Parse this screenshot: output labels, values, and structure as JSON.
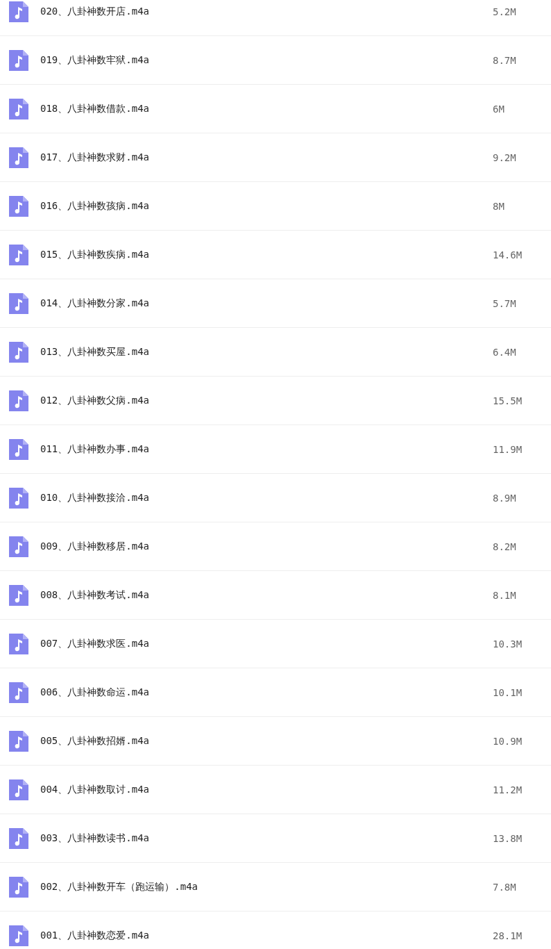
{
  "files": [
    {
      "name": "020、八卦神数开店.m4a",
      "size": "5.2M"
    },
    {
      "name": "019、八卦神数牢狱.m4a",
      "size": "8.7M"
    },
    {
      "name": "018、八卦神数借款.m4a",
      "size": "6M"
    },
    {
      "name": "017、八卦神数求财.m4a",
      "size": "9.2M"
    },
    {
      "name": "016、八卦神数孩病.m4a",
      "size": "8M"
    },
    {
      "name": "015、八卦神数疾病.m4a",
      "size": "14.6M"
    },
    {
      "name": "014、八卦神数分家.m4a",
      "size": "5.7M"
    },
    {
      "name": "013、八卦神数买屋.m4a",
      "size": "6.4M"
    },
    {
      "name": "012、八卦神数父病.m4a",
      "size": "15.5M"
    },
    {
      "name": "011、八卦神数办事.m4a",
      "size": "11.9M"
    },
    {
      "name": "010、八卦神数接洽.m4a",
      "size": "8.9M"
    },
    {
      "name": "009、八卦神数移居.m4a",
      "size": "8.2M"
    },
    {
      "name": "008、八卦神数考试.m4a",
      "size": "8.1M"
    },
    {
      "name": "007、八卦神数求医.m4a",
      "size": "10.3M"
    },
    {
      "name": "006、八卦神数命运.m4a",
      "size": "10.1M"
    },
    {
      "name": "005、八卦神数招婿.m4a",
      "size": "10.9M"
    },
    {
      "name": "004、八卦神数取讨.m4a",
      "size": "11.2M"
    },
    {
      "name": "003、八卦神数读书.m4a",
      "size": "13.8M"
    },
    {
      "name": "002、八卦神数开车（跑运输）.m4a",
      "size": "7.8M"
    },
    {
      "name": "001、八卦神数恋爱.m4a",
      "size": "28.1M"
    }
  ]
}
